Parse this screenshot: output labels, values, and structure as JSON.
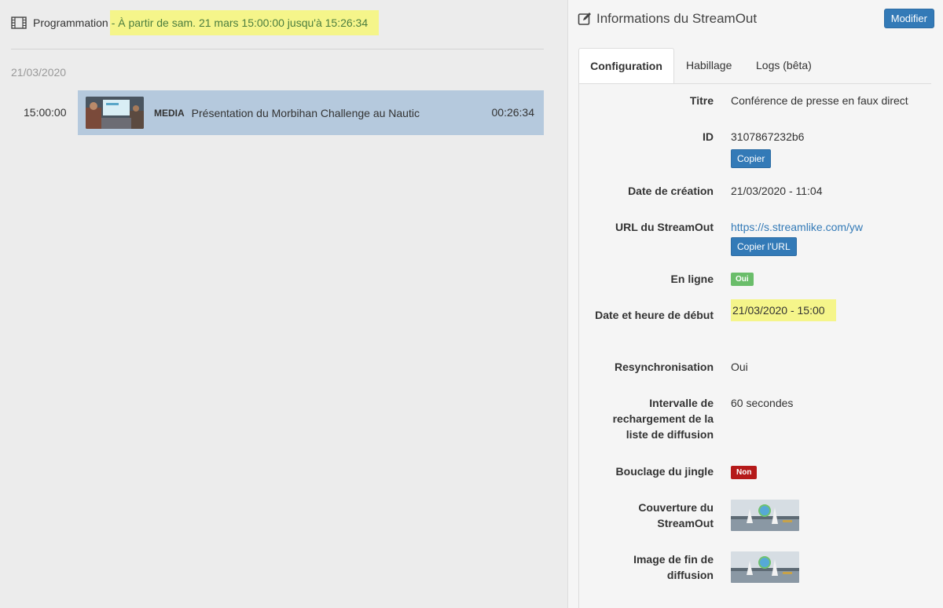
{
  "programmation": {
    "title": "Programmation",
    "range": "- À partir de sam. 21 mars 15:00:00 jusqu'à 15:26:34",
    "day": "21/03/2020",
    "entries": [
      {
        "time": "15:00:00",
        "type": "MEDIA",
        "title": "Présentation du Morbihan Challenge au Nautic",
        "duration": "00:26:34"
      }
    ]
  },
  "panel": {
    "title": "Informations du StreamOut",
    "edit_button": "Modifier",
    "tabs": [
      "Configuration",
      "Habillage",
      "Logs (bêta)"
    ],
    "fields": {
      "titre": {
        "label": "Titre",
        "value": "Conférence de presse en faux direct"
      },
      "id": {
        "label": "ID",
        "value": "3107867232b6",
        "button": "Copier"
      },
      "date_creation": {
        "label": "Date de création",
        "value": "21/03/2020 - 11:04"
      },
      "url": {
        "label": "URL du StreamOut",
        "value": "https://s.streamlike.com/yw",
        "button": "Copier l'URL"
      },
      "en_ligne": {
        "label": "En ligne",
        "value": "Oui"
      },
      "date_debut": {
        "label": "Date et heure de début",
        "value": "21/03/2020 - 15:00"
      },
      "resync": {
        "label": "Resynchronisation",
        "value": "Oui"
      },
      "intervalle": {
        "label": "Intervalle de rechargement de la liste de diffusion",
        "value": "60 secondes"
      },
      "bouclage": {
        "label": "Bouclage du jingle",
        "value": "Non"
      },
      "couverture": {
        "label": "Couverture du StreamOut"
      },
      "image_fin": {
        "label": "Image de fin de diffusion"
      }
    }
  },
  "colors": {
    "highlight": "#f5f58a",
    "primary": "#337ab7",
    "row_selected": "#b5c9dd",
    "badge_yes": "#5cb85c",
    "badge_no": "#b51a1a"
  }
}
